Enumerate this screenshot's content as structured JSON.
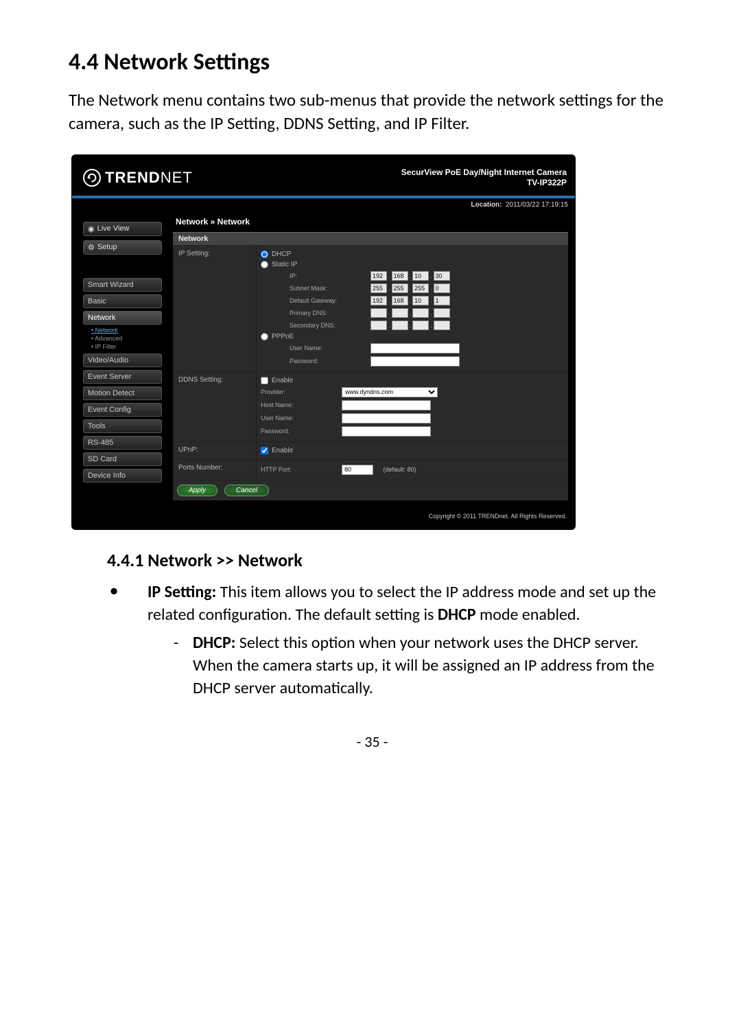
{
  "doc": {
    "section_title": "4.4  Network Settings",
    "intro": "The Network menu contains two sub-menus that provide the network settings for the camera, such as the IP Setting, DDNS Setting, and IP Filter.",
    "subsection_title": "4.4.1   Network >> Network",
    "bullet_lead_strong": "IP Setting:",
    "bullet_lead_rest": " This item allows you to select the IP address mode and set up the related configuration. The default setting is ",
    "bullet_lead_strong2": "DHCP",
    "bullet_lead_rest2": " mode enabled.",
    "dash_strong": "DHCP:",
    "dash_rest": " Select this option when your network uses the DHCP server. When the camera starts up, it will be assigned an IP address from the DHCP server automatically.",
    "page_number": "- 35 -"
  },
  "ui": {
    "brand": "TRENDNET",
    "product_line1": "SecurView PoE Day/Night Internet Camera",
    "product_model": "TV-IP322P",
    "location_label": "Location:",
    "location_value": "2011/03/22 17:19:15",
    "sidebar": {
      "live_view": "Live View",
      "setup": "Setup",
      "items": [
        "Smart Wizard",
        "Basic",
        "Network",
        "Video/Audio",
        "Event Server",
        "Motion Detect",
        "Event Config",
        "Tools",
        "RS-485",
        "SD Card",
        "Device Info"
      ],
      "subitems": [
        "Network",
        "Advanced",
        "IP Filter"
      ]
    },
    "breadcrumb": "Network » Network",
    "section_header": "Network",
    "labels": {
      "ip_setting": "IP Setting:",
      "dhcp": "DHCP",
      "static_ip": "Static IP",
      "ip": "IP:",
      "subnet": "Subnet Mask:",
      "gateway": "Default Gateway:",
      "primary_dns": "Primary DNS:",
      "secondary_dns": "Secondary DNS:",
      "pppoe": "PPPoE",
      "user_name": "User Name:",
      "password": "Password:",
      "ddns_setting": "DDNS Setting:",
      "enable": "Enable",
      "provider": "Provider:",
      "host_name": "Host Name:",
      "upnp": "UPnP:",
      "ports_number": "Ports Number:",
      "http_port": "HTTP Port:",
      "default80": "(default: 80)"
    },
    "values": {
      "ip": [
        "192",
        "168",
        "10",
        "30"
      ],
      "subnet": [
        "255",
        "255",
        "255",
        "0"
      ],
      "gateway": [
        "192",
        "168",
        "10",
        "1"
      ],
      "pdns": [
        "",
        "",
        "",
        ""
      ],
      "sdns": [
        "",
        "",
        "",
        ""
      ],
      "provider_selected": "www.dyndns.com",
      "http_port": "80"
    },
    "buttons": {
      "apply": "Apply",
      "cancel": "Cancel"
    },
    "copyright": "Copyright © 2011 TRENDnet. All Rights Reserved."
  }
}
